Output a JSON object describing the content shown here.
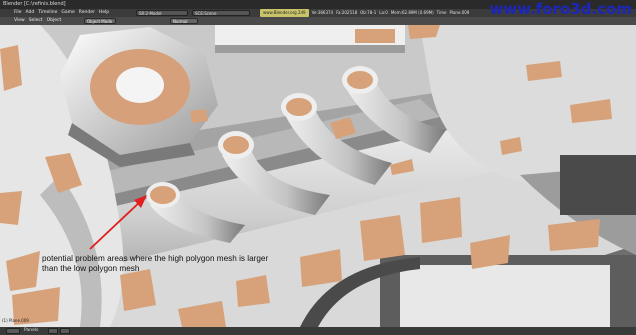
{
  "window": {
    "title": "Blender [C:\\refinis.blend]"
  },
  "watermark": "www.foro3d.com",
  "menubar": {
    "items": [
      "File",
      "Add",
      "Timeline",
      "Game",
      "Render",
      "Help"
    ]
  },
  "screen_field": "SR:2-Model",
  "scene_field": "SCE:Scene",
  "stats": {
    "engine": "www.Blender.org 249",
    "verts": "Ve:366374",
    "faces": "Fa:202518",
    "objects": "Ob:78-1",
    "lamps": "La:0",
    "memory": "Mem:62.89M (0.69M)",
    "time": "Time",
    "object": "Plane.009"
  },
  "viewport_header": {
    "items": [
      "View",
      "Select",
      "Object"
    ],
    "mode": "Object Mode",
    "shading": "Normal"
  },
  "annotation": {
    "text": "potential problem areas where the high polygon mesh is larger than the low polygon mesh"
  },
  "colors": {
    "skin_patch": "#d7a27a",
    "mesh_light": "#e2e2e2",
    "mesh_shadow": "#7c7c7c",
    "arrow": "#e11f1f",
    "watermark": "#1c26b8"
  },
  "bottom": {
    "frame_label": "Panels",
    "corner_text": "(1) Plane.009"
  }
}
